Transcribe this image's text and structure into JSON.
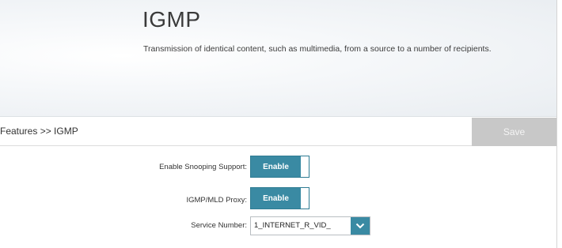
{
  "header": {
    "title": "IGMP",
    "description": "Transmission of identical content, such as multimedia, from a source to a number of recipients."
  },
  "breadcrumb": "Features >> IGMP",
  "toolbar": {
    "save_label": "Save"
  },
  "form": {
    "snooping": {
      "label": "Enable Snooping Support:",
      "value": "Enable"
    },
    "proxy": {
      "label": "IGMP/MLD Proxy:",
      "value": "Enable"
    },
    "service": {
      "label": "Service Number:",
      "value": "1_INTERNET_R_VID_"
    }
  },
  "colors": {
    "accent": "#3a8aa3",
    "save_disabled": "#c8c8c8"
  },
  "icons": {
    "select_arrow": "chevron-down-icon"
  }
}
